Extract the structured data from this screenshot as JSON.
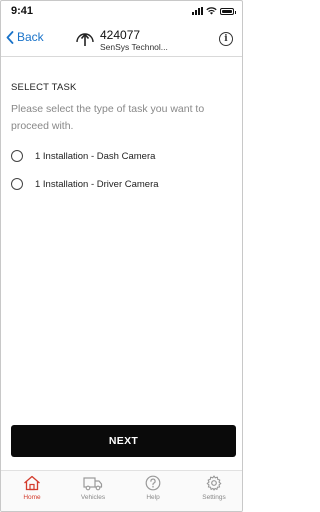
{
  "status_bar": {
    "time": "9:41"
  },
  "header": {
    "back_label": "Back",
    "device_id": "424077",
    "device_subtitle": "SenSys Technol..."
  },
  "task": {
    "title": "SELECT TASK",
    "description": "Please select the type of task you want to proceed with.",
    "options": [
      {
        "label": "1 Installation - Dash Camera",
        "selected": false
      },
      {
        "label": "1 Installation - Driver Camera",
        "selected": false
      }
    ]
  },
  "next_button": {
    "label": "NEXT"
  },
  "tab_bar": {
    "items": [
      {
        "label": "Home",
        "icon": "home-icon",
        "active": true
      },
      {
        "label": "Vehicles",
        "icon": "truck-icon",
        "active": false
      },
      {
        "label": "Help",
        "icon": "help-icon",
        "active": false
      },
      {
        "label": "Settings",
        "icon": "gear-icon",
        "active": false
      }
    ]
  },
  "colors": {
    "accent": "#1a73c9",
    "active_tab": "#d33b2c",
    "button_bg": "#0a0a0a"
  }
}
